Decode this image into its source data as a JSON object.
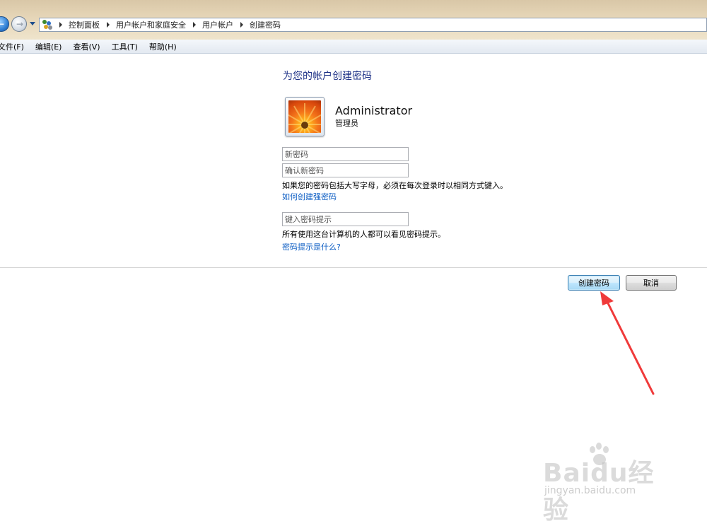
{
  "address_bar": {
    "breadcrumbs": [
      "控制面板",
      "用户帐户和家庭安全",
      "用户帐户",
      "创建密码"
    ]
  },
  "menu": {
    "items": [
      "文件(F)",
      "编辑(E)",
      "查看(V)",
      "工具(T)",
      "帮助(H)"
    ]
  },
  "page": {
    "heading": "为您的帐户创建密码",
    "user": {
      "name": "Administrator",
      "role": "管理员"
    },
    "new_password_placeholder": "新密码",
    "confirm_password_placeholder": "确认新密码",
    "caps_note": "如果您的密码包括大写字母，必须在每次登录时以相同方式键入。",
    "strong_password_link": "如何创建强密码",
    "hint_placeholder": "键入密码提示",
    "hint_note": "所有使用这台计算机的人都可以看见密码提示。",
    "hint_link": "密码提示是什么?"
  },
  "buttons": {
    "create": "创建密码",
    "cancel": "取消"
  },
  "annotation": {
    "color": "#f03a3a"
  },
  "watermark": {
    "main": "Baidu经验",
    "sub": "jingyan.baidu.com"
  }
}
